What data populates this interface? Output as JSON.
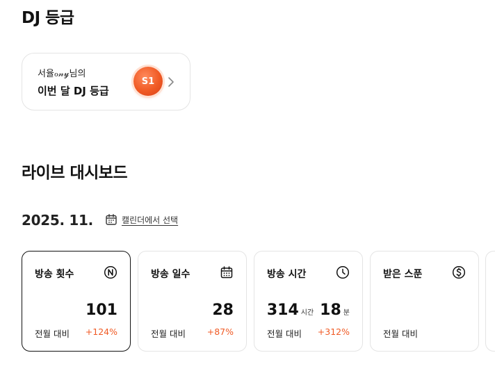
{
  "dj_section": {
    "title": "DJ 등급",
    "card": {
      "user_label": "서율ℴ𝓃𝓎님의",
      "grade_label": "이번 달 DJ 등급",
      "badge": "S1"
    }
  },
  "live_section": {
    "title": "라이브 대시보드",
    "month": "2025. 11.",
    "calendar_select_label": "캘린더에서 선택"
  },
  "stats": [
    {
      "title": "방송 횟수",
      "icon": "n-circle-icon",
      "value": "101",
      "compare_label": "전월 대비",
      "change": "+124%"
    },
    {
      "title": "방송 일수",
      "icon": "calendar-icon",
      "value": "28",
      "compare_label": "전월 대비",
      "change": "+87%"
    },
    {
      "title": "방송 시간",
      "icon": "clock-icon",
      "hours": "314",
      "hours_unit": "시간",
      "minutes": "18",
      "minutes_unit": "분",
      "compare_label": "전월 대비",
      "change": "+312%"
    },
    {
      "title": "받은 스푼",
      "icon": "spoon-coin-icon",
      "compare_label": "전월 대비"
    }
  ],
  "colors": {
    "accent": "#f05a24",
    "card_border": "#e4e4e4",
    "active_border": "#111111"
  }
}
